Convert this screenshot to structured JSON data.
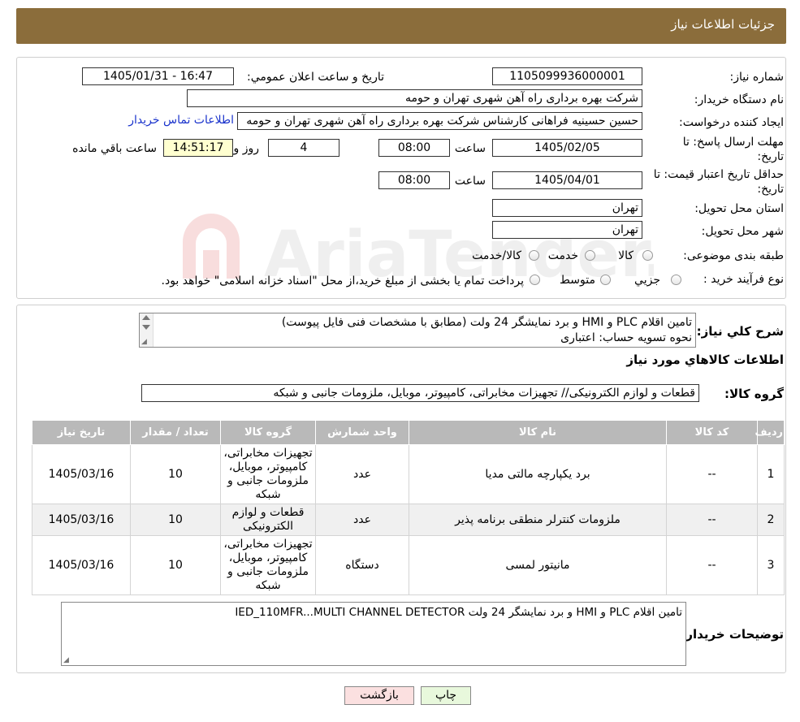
{
  "header": {
    "title": "جزئیات اطلاعات نیاز"
  },
  "form": {
    "need_number_label": "شماره نیاز:",
    "need_number": "1105099936000001",
    "announce_label": "تاریخ و ساعت اعلان عمومي:",
    "announce_value": "1405/01/31 - 16:47",
    "buyer_org_label": "نام دستگاه خريدار:",
    "buyer_org": "شرکت بهره برداری راه آهن شهری تهران و حومه",
    "creator_label": "ايجاد کننده درخواست:",
    "creator": "حسین حسینیه فراهانی کارشناس شرکت بهره برداری راه آهن شهری تهران و حومه",
    "contact_link": "اطلاعات تماس خريدار",
    "deadline_label_1": "مهلت ارسال پاسخ: تا",
    "deadline_label_2": "تاريخ:",
    "deadline_date": "1405/02/05",
    "time_label": "ساعت",
    "deadline_time": "08:00",
    "days": "4",
    "days_label": "روز و",
    "remaining_time": "14:51:17",
    "remaining_label": "ساعت باقي مانده",
    "validity_label_1": "حداقل تاريخ اعتبار قيمت: تا",
    "validity_label_2": "تاريخ:",
    "validity_date": "1405/04/01",
    "validity_time": "08:00",
    "province_label": "استان محل تحويل:",
    "province": "تهران",
    "city_label": "شهر محل تحويل:",
    "city": "تهران",
    "category_label": "طبقه بندی موضوعی:",
    "category_options": [
      "کالا",
      "خدمت",
      "کالا/خدمت"
    ],
    "process_label": "نوع فرآيند خريد :",
    "process_options": [
      "جزيي",
      "متوسط"
    ],
    "process_note": "پرداخت تمام يا بخشی از مبلغ خريد،از محل \"اسناد خزانه اسلامی\" خواهد بود."
  },
  "description": {
    "label": "شرح کلي نياز:",
    "line1": "تامین اقلام PLC و HMI و برد نمایشگر 24 ولت (مطابق با مشخصات فنی فایل پیوست)",
    "line2": "نحوه تسویه حساب: اعتباری"
  },
  "goods": {
    "section_title": "اطلاعات کالاهاي مورد نياز",
    "group_label": "گروه کالا:",
    "group_value": "قطعات و لوازم الکترونیکی// تجهیزات مخابراتی، کامپیوتر، موبایل، ملزومات جانبی و شبکه",
    "columns": [
      "رديف",
      "کد کالا",
      "نام کالا",
      "واحد شمارش",
      "گروه کالا",
      "تعداد / مقدار",
      "تاريخ نياز"
    ],
    "rows": [
      {
        "row": "1",
        "code": "--",
        "name": "برد یکپارچه مالتی مدیا",
        "unit": "عدد",
        "group": "تجهیزات مخابراتی، کامپیوتر، موبایل، ملزومات جانبی و شبکه",
        "qty": "10",
        "date": "1405/03/16"
      },
      {
        "row": "2",
        "code": "--",
        "name": "ملزومات کنترلر منطقی برنامه پذیر",
        "unit": "عدد",
        "group": "قطعات و لوازم الکترونیکی",
        "qty": "10",
        "date": "1405/03/16"
      },
      {
        "row": "3",
        "code": "--",
        "name": "مانیتور لمسی",
        "unit": "دستگاه",
        "group": "تجهیزات مخابراتی، کامپیوتر، موبایل، ملزومات جانبی و شبکه",
        "qty": "10",
        "date": "1405/03/16"
      }
    ]
  },
  "buyer_notes": {
    "label": "توضيحات خريدار:",
    "text": "تامین اقلام PLC و HMI و برد نمایشگر 24 ولت IED_110MFR...MULTI CHANNEL DETECTOR"
  },
  "buttons": {
    "print": "چاپ",
    "back": "بازگشت"
  },
  "watermark": {
    "text": "AriaTender.neT"
  },
  "colors": {
    "header_bg": "#8b6d3b",
    "table_header_bg": "#b9b9b9",
    "back_button_bg": "#fbe0e0",
    "print_button_bg": "#e8f8dc",
    "link": "#1a33cc"
  }
}
